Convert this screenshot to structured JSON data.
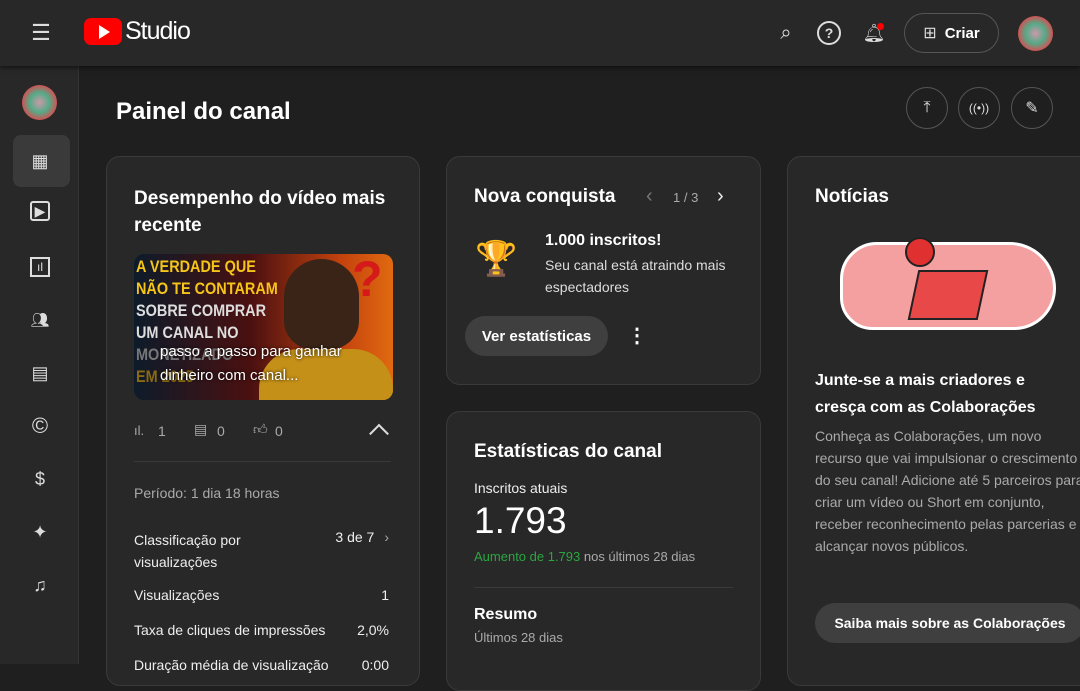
{
  "header": {
    "logo_text": "Studio",
    "create_label": "Criar"
  },
  "page": {
    "title": "Painel do canal"
  },
  "sidebar": {
    "items": [
      {
        "name": "dashboard",
        "icon": "▦"
      },
      {
        "name": "content",
        "icon": "▶"
      },
      {
        "name": "analytics",
        "icon": "📊"
      },
      {
        "name": "community",
        "icon": "👥"
      },
      {
        "name": "subtitles",
        "icon": "▤"
      },
      {
        "name": "copyright",
        "icon": "©"
      },
      {
        "name": "earn",
        "icon": "$"
      },
      {
        "name": "customization",
        "icon": "✦"
      },
      {
        "name": "audio-library",
        "icon": "♫"
      }
    ]
  },
  "video_card": {
    "title": "Desempenho do vídeo mais recente",
    "thumb_lines": [
      "A VERDADE QUE",
      "NÃO TE CONTARAM",
      "SOBRE COMPRAR",
      "UM CANAL NO",
      "MONETIZADO",
      "EM 2025"
    ],
    "overlay_title": "passo a passo para ganhar dinheiro com canal...",
    "views": "1",
    "comments": "0",
    "likes": "0",
    "period": "Período: 1 dia 18 horas",
    "rows": [
      {
        "label": "Classificação por visualizações",
        "value": "3 de 7"
      },
      {
        "label": "Visualizações",
        "value": "1"
      },
      {
        "label": "Taxa de cliques de impressões",
        "value": "2,0%"
      },
      {
        "label": "Duração média de visualização",
        "value": "0:00"
      }
    ]
  },
  "achievement": {
    "title": "Nova conquista",
    "pager": "1 / 3",
    "headline": "1.000 inscritos!",
    "desc": "Seu canal está atraindo mais espectadores",
    "button": "Ver estatísticas"
  },
  "stats": {
    "title": "Estatísticas do canal",
    "subs_label": "Inscritos atuais",
    "subs_value": "1.793",
    "increase": "Aumento de 1.793",
    "increase_suffix": " nos últimos 28 dias",
    "summary": "Resumo",
    "summary_period": "Últimos 28 dias"
  },
  "news": {
    "title": "Notícias",
    "headline": "Junte-se a mais criadores e cresça com as Colaborações",
    "body": "Conheça as Colaborações, um novo recurso que vai impulsionar o crescimento do seu canal! Adicione até 5 parceiros para criar um vídeo ou Short em conjunto, receber reconhecimento pelas parcerias e alcançar novos públicos.",
    "button": "Saiba mais sobre as Colaborações"
  },
  "colors": {
    "accent_red": "#ff0000",
    "green": "#2ba640"
  }
}
